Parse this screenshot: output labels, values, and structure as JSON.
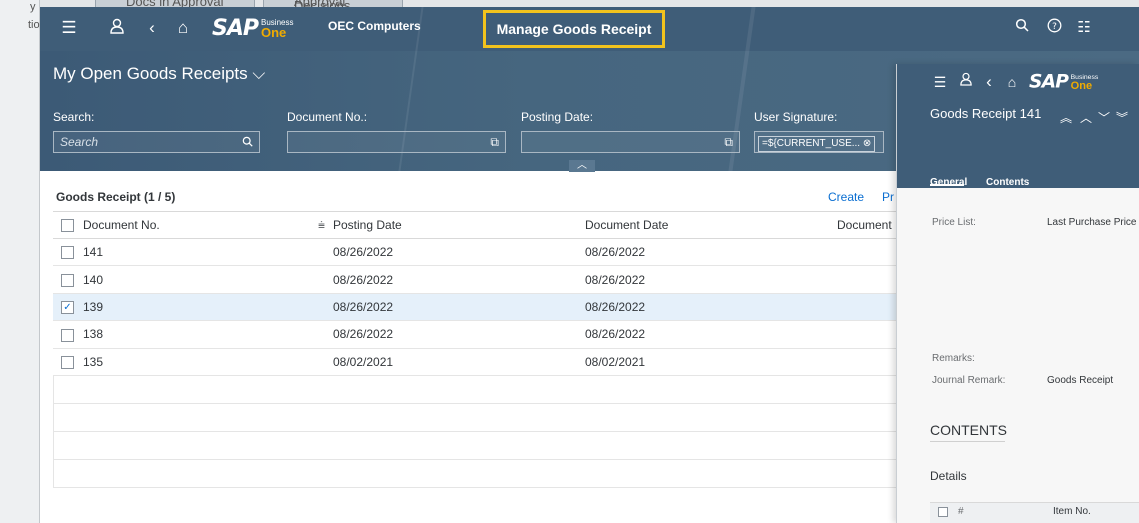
{
  "background": {
    "tabs": [
      "Docs in Approval",
      "Approval Decisions"
    ],
    "side_text": [
      "y",
      "tio"
    ]
  },
  "shell": {
    "company": "OEC Computers",
    "app_title": "Manage Goods Receipt",
    "logo_main": "SAP",
    "logo_sub1": "Business",
    "logo_sub2": "One"
  },
  "filterbar": {
    "variant": "My Open Goods Receipts",
    "search_label": "Search:",
    "search_placeholder": "Search",
    "docno_label": "Document No.:",
    "posting_label": "Posting Date:",
    "usersig_label": "User Signature:",
    "usersig_value": "=${CURRENT_USE..."
  },
  "table": {
    "title": "Goods Receipt (1 / 5)",
    "create": "Create",
    "extra_btn": "Pr",
    "columns": [
      "Document No.",
      "Posting Date",
      "Document Date",
      "Document"
    ],
    "rows": [
      {
        "doc": "141",
        "posting": "08/26/2022",
        "docdate": "08/26/2022",
        "checked": false
      },
      {
        "doc": "140",
        "posting": "08/26/2022",
        "docdate": "08/26/2022",
        "checked": false
      },
      {
        "doc": "139",
        "posting": "08/26/2022",
        "docdate": "08/26/2022",
        "checked": true
      },
      {
        "doc": "138",
        "posting": "08/26/2022",
        "docdate": "08/26/2022",
        "checked": false
      },
      {
        "doc": "135",
        "posting": "08/02/2021",
        "docdate": "08/02/2021",
        "checked": false
      }
    ]
  },
  "panel": {
    "title": "Goods Receipt 141",
    "tab_general": "General",
    "tab_contents": "Contents",
    "price_list_label": "Price List:",
    "price_list_value": "Last Purchase Price",
    "remarks_label": "Remarks:",
    "journal_label": "Journal Remark:",
    "journal_value": "Goods Receipt",
    "contents_header": "CONTENTS",
    "details": "Details",
    "col_hash": "#",
    "col_item": "Item No."
  }
}
